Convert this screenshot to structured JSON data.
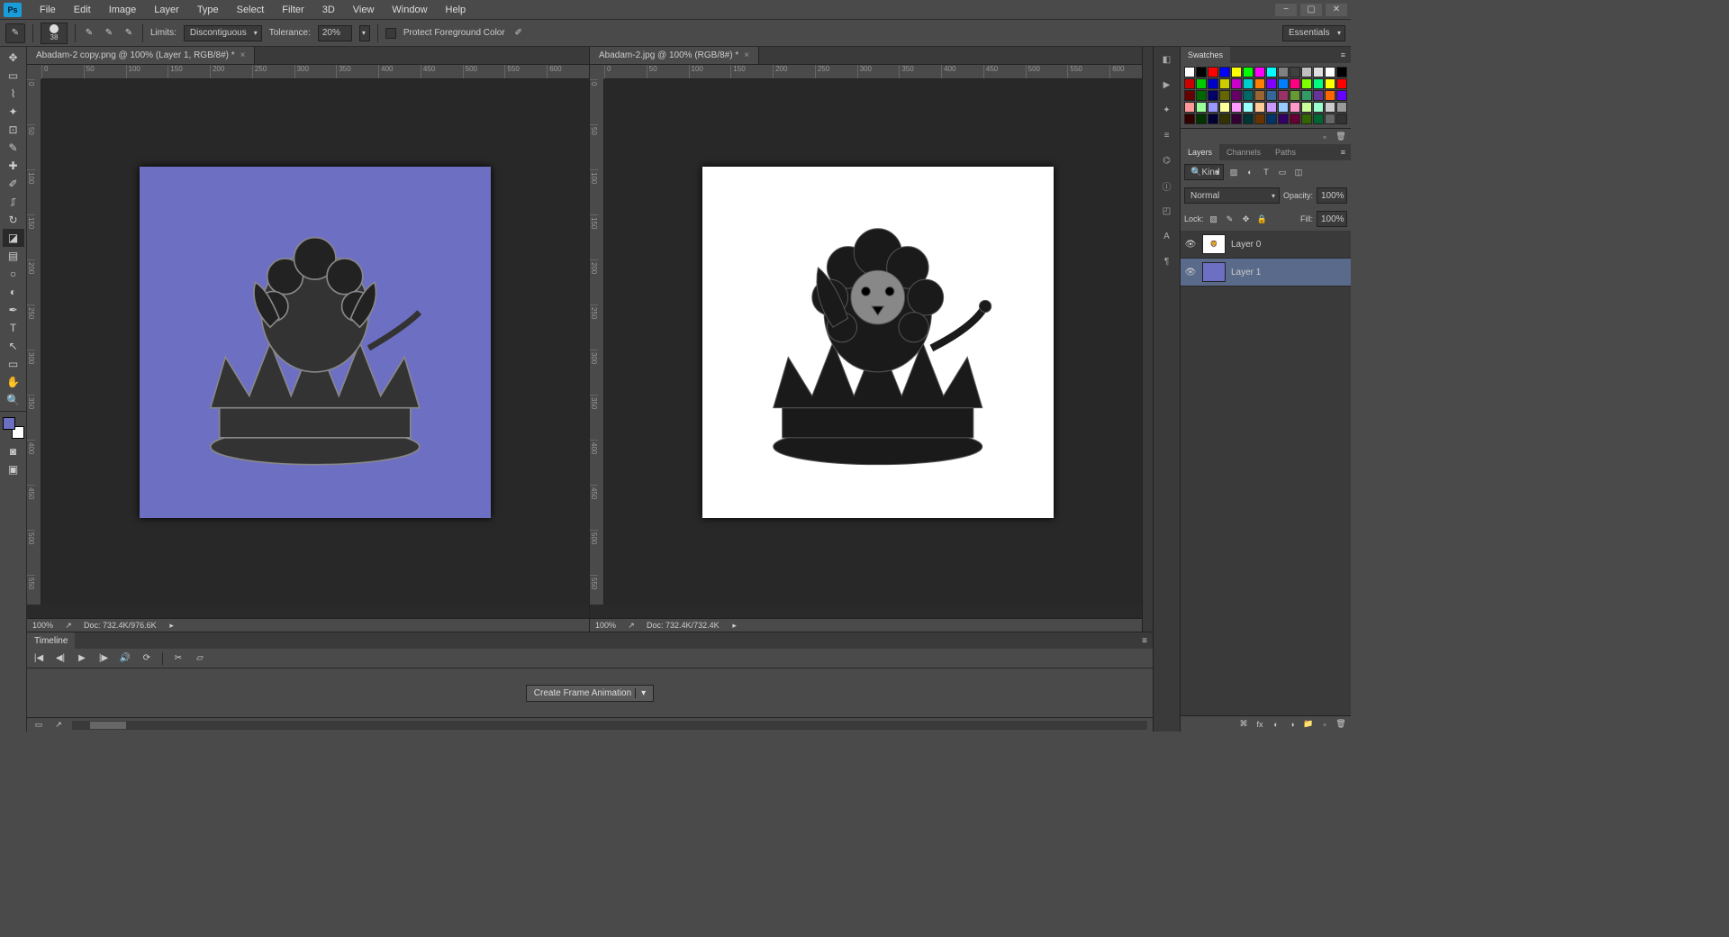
{
  "menu": {
    "items": [
      "File",
      "Edit",
      "Image",
      "Layer",
      "Type",
      "Select",
      "Filter",
      "3D",
      "View",
      "Window",
      "Help"
    ]
  },
  "options_bar": {
    "brush_size": "38",
    "limits_label": "Limits:",
    "limits_value": "Discontiguous",
    "tolerance_label": "Tolerance:",
    "tolerance_value": "20%",
    "protect_fg": "Protect Foreground Color",
    "workspace": "Essentials"
  },
  "documents": [
    {
      "tab_title": "Abadam-2 copy.png @ 100% (Layer 1, RGB/8#) *",
      "zoom": "100%",
      "doc_info": "Doc: 732.4K/976.6K",
      "bg_color": "purple"
    },
    {
      "tab_title": "Abadam-2.jpg @ 100% (RGB/8#) *",
      "zoom": "100%",
      "doc_info": "Doc: 732.4K/732.4K",
      "bg_color": "white"
    }
  ],
  "swatches": {
    "title": "Swatches"
  },
  "layers_panel": {
    "tabs": [
      "Layers",
      "Channels",
      "Paths"
    ],
    "kind_label": "Kind",
    "blend_mode": "Normal",
    "opacity_label": "Opacity:",
    "opacity_value": "100%",
    "lock_label": "Lock:",
    "fill_label": "Fill:",
    "fill_value": "100%",
    "layers": [
      {
        "name": "Layer 0",
        "thumb": "img",
        "selected": false
      },
      {
        "name": "Layer 1",
        "thumb": "purple",
        "selected": true
      }
    ]
  },
  "timeline": {
    "title": "Timeline",
    "create_button": "Create Frame Animation"
  },
  "ruler_marks_h": [
    "0",
    "50",
    "100",
    "150",
    "200",
    "250",
    "300",
    "350",
    "400",
    "450",
    "500",
    "550",
    "600"
  ],
  "ruler_marks_v": [
    "0",
    "50",
    "100",
    "150",
    "200",
    "250",
    "300",
    "350",
    "400",
    "450",
    "500",
    "550"
  ],
  "swatch_colors": [
    "#ffffff",
    "#000000",
    "#ff0000",
    "#0000ff",
    "#ffff00",
    "#00ff00",
    "#ff00ff",
    "#00ffff",
    "#808080",
    "#404040",
    "#c0c0c0",
    "#e0e0e0",
    "#ffffff",
    "#000000",
    "#cc0000",
    "#00cc00",
    "#0000cc",
    "#cccc00",
    "#cc00cc",
    "#00cccc",
    "#ff8000",
    "#8000ff",
    "#0080ff",
    "#ff0080",
    "#80ff00",
    "#00ff80",
    "#ffff00",
    "#ff0000",
    "#660000",
    "#006600",
    "#000066",
    "#666600",
    "#660066",
    "#006666",
    "#996633",
    "#336699",
    "#993366",
    "#669933",
    "#339966",
    "#663399",
    "#ff6600",
    "#6600ff",
    "#ff9999",
    "#99ff99",
    "#9999ff",
    "#ffff99",
    "#ff99ff",
    "#99ffff",
    "#ffcc99",
    "#cc99ff",
    "#99ccff",
    "#ff99cc",
    "#ccff99",
    "#99ffcc",
    "#cccccc",
    "#999999",
    "#330000",
    "#003300",
    "#000033",
    "#333300",
    "#330033",
    "#003333",
    "#663300",
    "#003366",
    "#330066",
    "#660033",
    "#336600",
    "#006633",
    "#666666",
    "#333333"
  ]
}
